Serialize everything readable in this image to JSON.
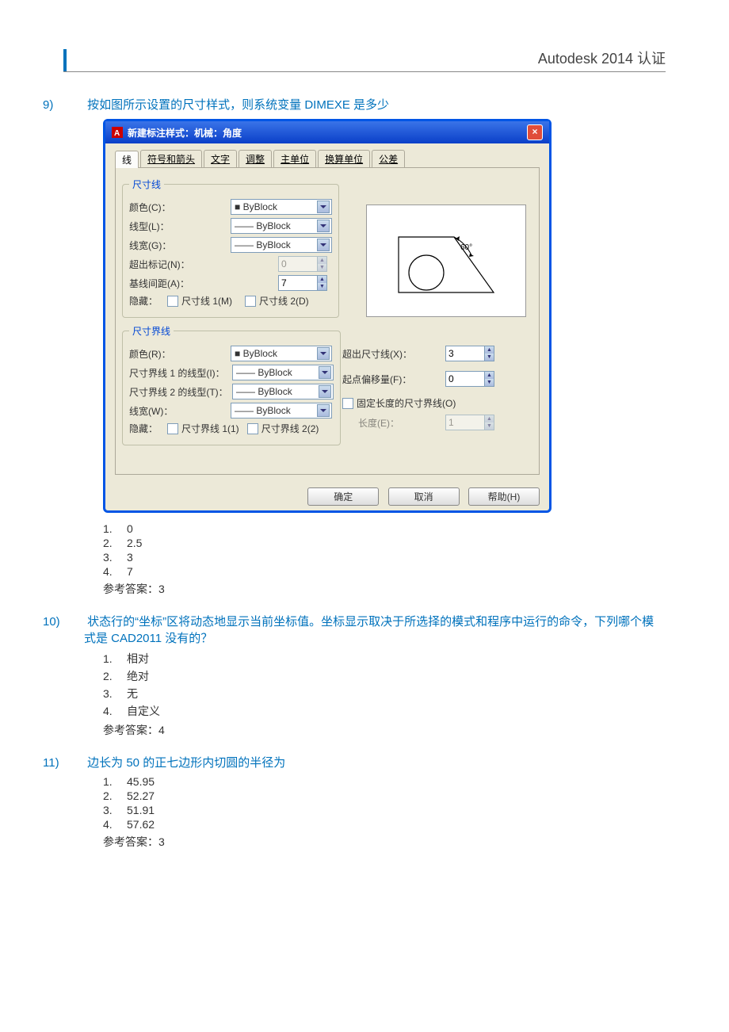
{
  "header": {
    "title": "Autodesk 2014 认证"
  },
  "q9": {
    "num": "9)",
    "text": "按如图所示设置的尺寸样式，则系统变量 DIMEXE 是多少",
    "options": [
      "0",
      "2.5",
      "3",
      "7"
    ],
    "answer_label": "参考答案：",
    "answer": "3"
  },
  "q10": {
    "num": "10)",
    "text": "状态行的“坐标”区将动态地显示当前坐标值。坐标显示取决于所选择的模式和程序中运行的命令，下列哪个模式是 CAD2011 没有的？",
    "options": [
      "相对",
      "绝对",
      "无",
      "自定义"
    ],
    "answer_label": "参考答案：",
    "answer": "4"
  },
  "q11": {
    "num": "11)",
    "text": "边长为 50 的正七边形内切圆的半径为",
    "options": [
      "45.95",
      "52.27",
      "51.91",
      "57.62"
    ],
    "answer_label": "参考答案：",
    "answer": "3"
  },
  "dialog": {
    "title": "新建标注样式：机械：角度",
    "tabs": [
      "线",
      "符号和箭头",
      "文字",
      "调整",
      "主单位",
      "换算单位",
      "公差"
    ],
    "dim_line_legend": "尺寸线",
    "ext_line_legend": "尺寸界线",
    "labels": {
      "color_c": "颜色(C)：",
      "ltype_l": "线型(L)：",
      "lweight_g": "线宽(G)：",
      "ext_mark_n": "超出标记(N)：",
      "base_gap_a": "基线间距(A)：",
      "hide": "隐藏：",
      "dl1": "尺寸线 1(M)",
      "dl2": "尺寸线 2(D)",
      "color_r": "颜色(R)：",
      "ext1_ltype": "尺寸界线 1 的线型(I)：",
      "ext2_ltype": "尺寸界线 2 的线型(T)：",
      "lweight_w": "线宽(W)：",
      "el1": "尺寸界线 1(1)",
      "el2": "尺寸界线 2(2)",
      "ext_beyond_x": "超出尺寸线(X)：",
      "offset_f": "起点偏移量(F)：",
      "fixed_len_o": "固定长度的尺寸界线(O)",
      "length_e": "长度(E)："
    },
    "values": {
      "byblock": "ByBlock",
      "ext_mark": "0",
      "base_gap": "7",
      "ext_beyond": "3",
      "offset": "0",
      "length": "1"
    },
    "preview_angle": "60°",
    "buttons": {
      "ok": "确定",
      "cancel": "取消",
      "help": "帮助(H)"
    }
  }
}
